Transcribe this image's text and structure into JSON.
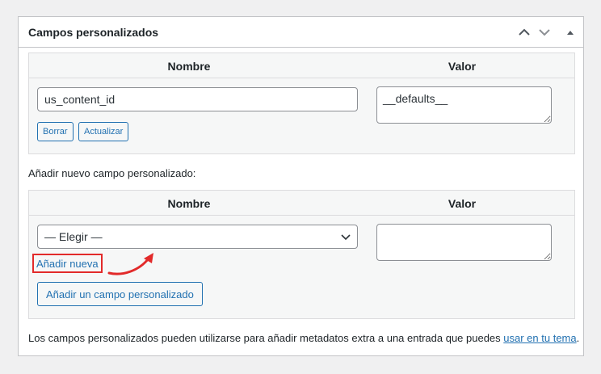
{
  "panel": {
    "title": "Campos personalizados",
    "icons": {
      "move_up": "chevron-up-icon",
      "move_down": "chevron-down-icon",
      "toggle": "triangle-up-icon"
    }
  },
  "existing": {
    "columns": {
      "name": "Nombre",
      "value": "Valor"
    },
    "field": {
      "name": "us_content_id",
      "value": "__defaults__"
    },
    "delete_label": "Borrar",
    "update_label": "Actualizar"
  },
  "add_new": {
    "heading": "Añadir nuevo campo personalizado:",
    "columns": {
      "name": "Nombre",
      "value": "Valor"
    },
    "select_value": "— Elegir —",
    "add_new_link": "Añadir nueva",
    "submit_label": "Añadir un campo personalizado",
    "value_text": ""
  },
  "footer": {
    "text": "Los campos personalizados pueden utilizarse para añadir metadatos extra a una entrada que puedes ",
    "link": "usar en tu tema",
    "after": "."
  },
  "colors": {
    "accent": "#2271b1",
    "highlight": "#e22a2a",
    "border": "#c3c4c7"
  }
}
